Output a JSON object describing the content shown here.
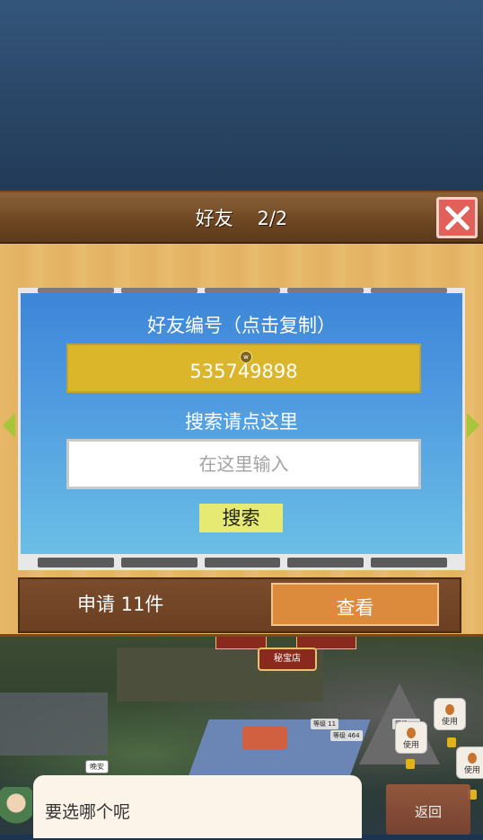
{
  "dialog_title": {
    "label": "好友",
    "count": "2/2"
  },
  "card": {
    "id_label": "好友编号（点击复制）",
    "friend_id": "535749898",
    "coin_icon_letter": "w",
    "search_label": "搜索请点这里",
    "search_placeholder": "在这里输入",
    "search_button": "搜索"
  },
  "requests": {
    "text": "申请 11件",
    "view_button": "查看"
  },
  "world": {
    "shop_sign": "秘宝店",
    "use_label": "使用",
    "chip_1": "等级 11",
    "chip_2": "等级 464",
    "chip_3": "等级 14",
    "tag_small": "晚安"
  },
  "bottom_dialog": {
    "prompt": "要选哪个呢",
    "back_button": "返回"
  },
  "colors": {
    "panel_wood": "#e6b868",
    "card_top": "#3d86d8",
    "card_bottom": "#6bbfe6",
    "id_box": "#dbb52a",
    "search_btn": "#e7ea72",
    "view_btn": "#dc8a3c",
    "close_btn": "#e2605a",
    "arrow": "#a8c63a"
  }
}
